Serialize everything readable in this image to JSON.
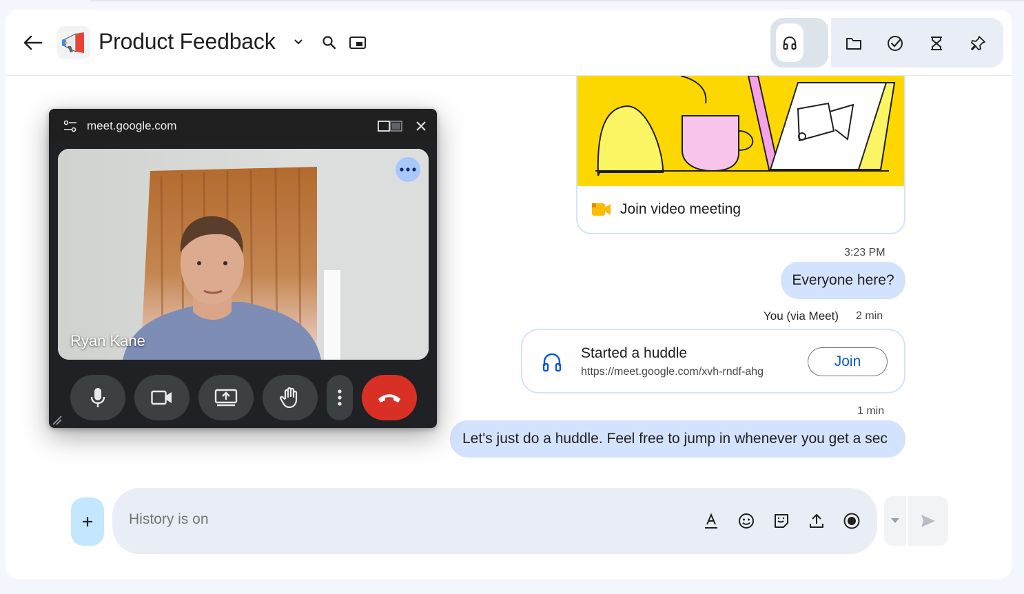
{
  "header": {
    "space_title": "Product Feedback"
  },
  "meet_card": {
    "join_label": "Join video meeting"
  },
  "messages": {
    "timestamp_1": "3:23 PM",
    "bubble_1": "Everyone here?",
    "sender": "You (via Meet)",
    "sender_time": "2 min",
    "huddle_title": "Started a huddle",
    "huddle_url": "https://meet.google.com/xvh-rndf-ahg",
    "join_label": "Join",
    "timestamp_2": "1 min",
    "bubble_2": "Let's just do a huddle. Feel free to jump in whenever you get a sec"
  },
  "composer": {
    "placeholder": "History is on",
    "icons": [
      "format-text-icon",
      "emoji-icon",
      "sticker-icon",
      "upload-icon",
      "record-icon"
    ]
  },
  "pip": {
    "url": "meet.google.com",
    "participant_name": "Ryan Kane"
  },
  "colors": {
    "bubble": "#d3e3fd",
    "accent": "#0b57d0",
    "end_call": "#d93025",
    "illustration": "#fdd800"
  }
}
